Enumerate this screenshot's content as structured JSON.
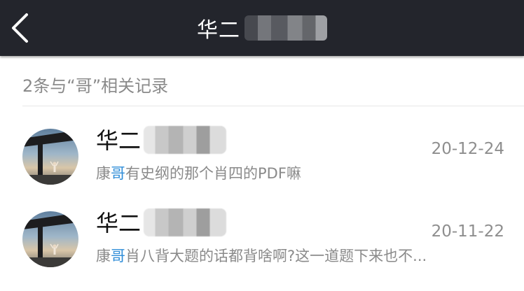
{
  "nav": {
    "title": "华二",
    "back_icon": "chevron-left-icon",
    "background": "#23252c"
  },
  "results": {
    "summary": "2条与“哥”相关记录",
    "highlight_color": "#2f8dd8",
    "items": [
      {
        "sender": "华二",
        "date": "20-12-24",
        "snippet_before": "康",
        "snippet_match": "哥",
        "snippet_after": "有史纲的那个肖四的PDF嘛"
      },
      {
        "sender": "华二",
        "date": "20-11-22",
        "snippet_before": "康",
        "snippet_match": "哥",
        "snippet_after": "肖八背大题的话都背啥啊?这一道题下来也不..."
      }
    ]
  }
}
